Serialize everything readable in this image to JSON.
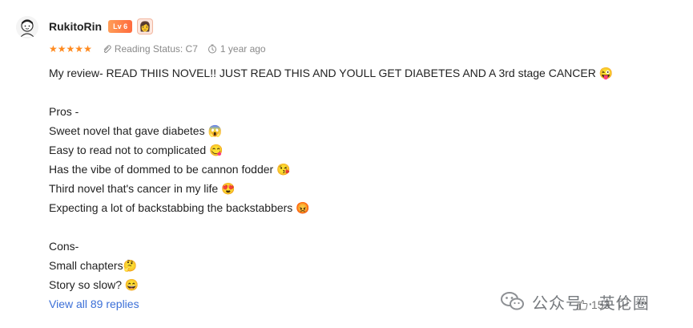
{
  "review": {
    "username": "RukitoRin",
    "level_badge": "Lv 6",
    "rating_stars": 5,
    "reading_status": "Reading Status: C7",
    "time_ago": "1 year ago",
    "lines": [
      "My review- READ THIIS NOVEL!! JUST READ THIS AND YOULL GET DIABETES AND A 3rd stage CANCER 😜",
      "",
      "Pros -",
      "Sweet novel that gave diabetes 😱",
      "Easy to read not to complicated 😋",
      "Has the vibe of dommed to be cannon fodder 😘",
      "Third novel that's cancer in my life 😍",
      "Expecting a lot of backstabbing the backstabbers 😡",
      "",
      "Cons-",
      "Small chapters🤔",
      "Story so slow? 😄"
    ],
    "view_replies": "View all 89 replies",
    "likes": "153"
  },
  "watermark": {
    "text": "公众号 · 英伦圈"
  },
  "colors": {
    "star": "#ff8a1f",
    "link": "#3b6fd7",
    "badge": "#ff7a45"
  },
  "icons": {
    "avatar": "avatar-icon",
    "clip": "paperclip-icon",
    "clock": "clock-icon",
    "like": "thumbs-up-icon",
    "comment": "comment-icon"
  }
}
